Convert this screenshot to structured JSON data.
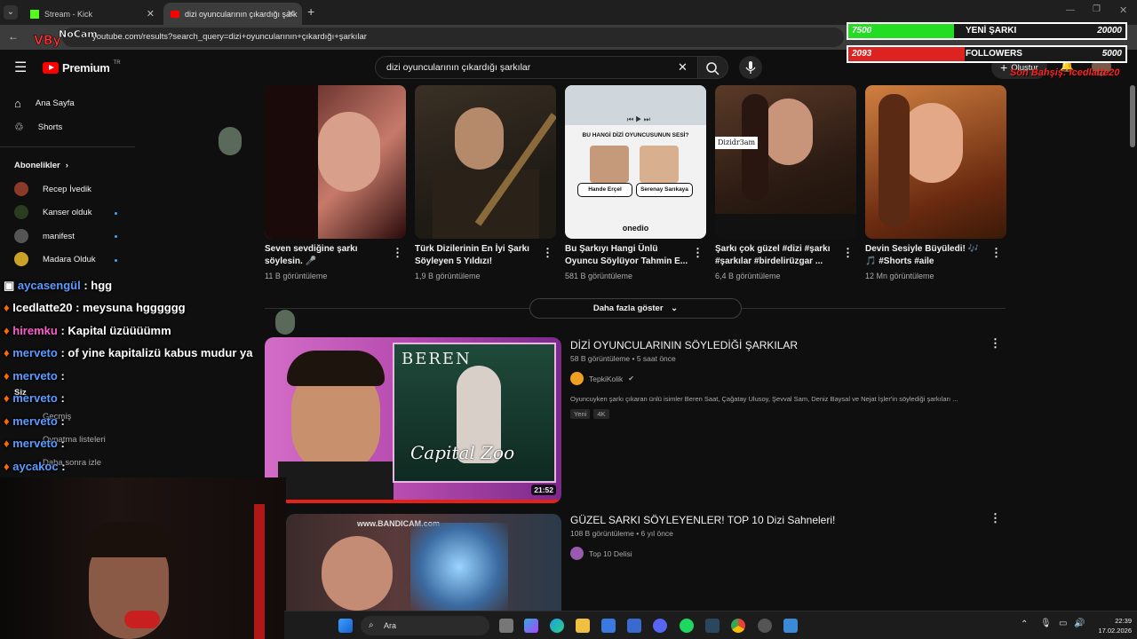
{
  "tabs": [
    {
      "label": "Stream - Kick",
      "active": false
    },
    {
      "label": "dizi oyuncularının çıkardığı şark",
      "active": true
    }
  ],
  "url": "youtube.com/results?search_query=dizi+oyuncularının+çıkardığı+şarkılar",
  "brand": {
    "name": "Premium",
    "region": "TR",
    "color": "#ff0000"
  },
  "search": {
    "query": "dizi oyuncularının çıkardığı şarkılar"
  },
  "header_actions": {
    "create": "Oluştur"
  },
  "sidebar": {
    "items": [
      {
        "label": "Ana Sayfa",
        "icon": "home-icon"
      },
      {
        "label": "Shorts",
        "icon": "shorts-icon"
      }
    ],
    "subs_header": "Abonelikler",
    "subscriptions": [
      {
        "label": "Recep İvedik",
        "new": false,
        "color": "#8b3a2a"
      },
      {
        "label": "Kanser olduk",
        "new": true,
        "color": "#2a3b1f"
      },
      {
        "label": "manifest",
        "new": true,
        "color": "#444"
      },
      {
        "label": "Madara Olduk",
        "new": true,
        "color": "#c9a227"
      }
    ],
    "you": "Siz",
    "you_items": [
      "Geçmiş",
      "Oynatma listeleri",
      "Daha sonra izle"
    ]
  },
  "shorts": [
    {
      "title": "Seven sevdiğine şarkı söylesin. 🎤",
      "views": "11 B görüntüleme",
      "colors": [
        "#4a1a1a",
        "#c77a6a"
      ]
    },
    {
      "title": "Türk Dizilerinin En İyi Şarkı Söyleyen 5 Yıldızı!",
      "views": "1,9 B görüntüleme",
      "colors": [
        "#2b2418",
        "#7a6a4a"
      ]
    },
    {
      "title": "Bu Şarkıyı Hangi Ünlü Oyuncu Söylüyor Tahmin E...",
      "views": "581 B görüntüleme",
      "colors": [
        "#dcdcdc",
        "#f4f4f4"
      ],
      "card": {
        "question": "BU HANGİ DİZİ OYUNCUSUNUN SESİ?",
        "option_a": "Hande Erçel",
        "option_b": "Serenay Sarıkaya",
        "logo": "onedio"
      }
    },
    {
      "title": "Şarkı çok güzel #dizi #şarkı #şarkılar #birdelirüzgar ...",
      "views": "6,4 B görüntüleme",
      "colors": [
        "#3a2418",
        "#8b5a3a"
      ],
      "tag": "Dizidr3am"
    },
    {
      "title": "Devin Sesiyle Büyüledi! 🎶 🎵 #Shorts #aile",
      "views": "12 Mn görüntüleme",
      "colors": [
        "#6a3a1a",
        "#e0a060"
      ]
    }
  ],
  "show_more": "Daha fazla göster",
  "videos": [
    {
      "title": "DİZİ OYUNCULARININ SÖYLEDİĞİ ŞARKILAR",
      "views": "58 B görüntüleme",
      "age": "5 saat önce",
      "channel": "TepkiKolik",
      "verified": true,
      "description": "Oyuncuyken şarkı çıkaran ünlü isimler Beren Saat, Çağatay Ulusoy, Şevval Sam, Deniz Baysal ve Nejat İşler'in söylediği şarkıları ...",
      "badges": [
        "Yeni",
        "4K"
      ],
      "duration": "21:52",
      "thumb_text_top": "BEREN",
      "thumb_text_bottom": "Capital Zoo"
    },
    {
      "title": "GÜZEL SARKI SÖYLEYENLER! TOP 10 Dizi Sahneleri!",
      "views": "108 B görüntüleme",
      "age": "6 yıl önce",
      "channel": "Top 10 Delisi",
      "verified": false,
      "watermark": "www.BANDICAM.com"
    }
  ],
  "chat": [
    {
      "user": "aycasengül",
      "msg": ": hgg"
    },
    {
      "user": "Icedlatte20",
      "msg": ": meysuna hgggggg"
    },
    {
      "user": "hiremku",
      "msg": ": Kapital üzüüüümm"
    },
    {
      "user": "merveto",
      "msg": ": of yine kapitalizü kabus mudur ya"
    },
    {
      "user": "merveto",
      "msg": ":"
    },
    {
      "user": "merveto",
      "msg": ":"
    },
    {
      "user": "merveto",
      "msg": ":"
    },
    {
      "user": "merveto",
      "msg": ":"
    },
    {
      "user": "aycakoc",
      "msg": ":"
    }
  ],
  "overlay": {
    "new_song": {
      "current": "7500",
      "label": "YENİ ŞARKI",
      "goal": "20000",
      "color": "#22dd22"
    },
    "followers": {
      "current": "2093",
      "label": "FOLLOWERS",
      "goal": "5000",
      "color": "#dd2222"
    },
    "last_tip": "Son Bahşiş: Icedlatte20"
  },
  "taskbar": {
    "search": "Ara",
    "time": "22:39",
    "date": "17.02.2026"
  }
}
